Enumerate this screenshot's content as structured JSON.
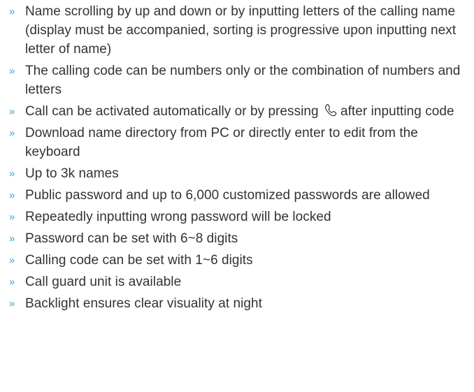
{
  "bullet_glyph": "»",
  "accent_color": "#3a9fd6",
  "text_color": "#333333",
  "features": [
    {
      "text": "Name scrolling by up and down or by inputting letters of the calling name (display must be accompanied, sorting is progressive upon inputting next letter of name)"
    },
    {
      "text": "The calling code can be numbers only or the combination of numbers and letters"
    },
    {
      "text_before": "Call can be activated automatically or by pressing ",
      "icon": "phone-handset-icon",
      "text_after": "after inputting code"
    },
    {
      "text": "Download name directory from PC or directly enter to edit from the keyboard"
    },
    {
      "text": "Up to 3k names"
    },
    {
      "text": "Public password and up to 6,000 customized passwords are allowed"
    },
    {
      "text": "Repeatedly inputting wrong password will be locked"
    },
    {
      "text": "Password can be set with 6~8 digits"
    },
    {
      "text": "Calling code can be set with 1~6 digits"
    },
    {
      "text": "Call guard unit is available"
    },
    {
      "text": "Backlight ensures clear visuality at night"
    }
  ]
}
